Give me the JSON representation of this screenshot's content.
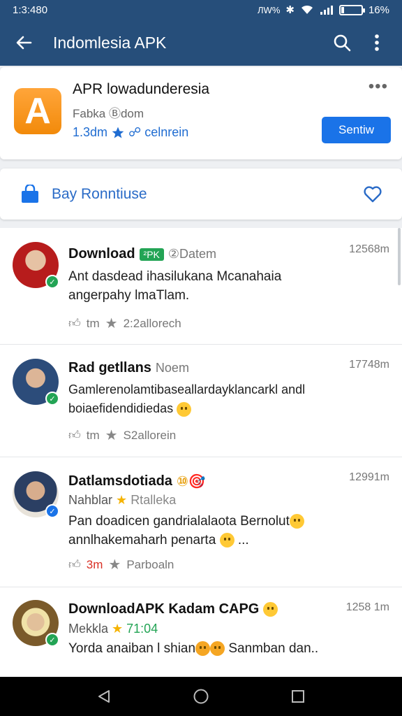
{
  "status_bar": {
    "time": "1:3:480",
    "network": "ЛW%",
    "battery_pct": "16%",
    "battery_level": 0.16
  },
  "app_bar": {
    "title": "Indomlesia APK",
    "icons": [
      "back-arrow-icon",
      "search-icon",
      "more-vert-icon"
    ]
  },
  "app_card": {
    "icon_letter": "A",
    "name": "APR lowadunderesia",
    "developer": "Fabka Ⓑdom",
    "rating": "1.3dm",
    "meta_tail": "celnrein",
    "more_label": "•••",
    "install_label": "Sentiw",
    "accent": "#1a73e8",
    "icon_color": "#f7971e"
  },
  "buy_card": {
    "label": "Bay Ronntiuse",
    "icons": [
      "shopping-bag-icon",
      "heart-icon"
    ]
  },
  "posts": [
    {
      "name": "Download",
      "badge": "²PK",
      "sub": "②Datem",
      "time": "12568m",
      "text1": "Ant dasdead ihasilukana Mcanahaia",
      "text2": "angerpahy lmaTlam.",
      "stat_a": "tm",
      "stat_b": "2:2allorech",
      "avatar_bg": "#b71c1c",
      "check_color": "#23a455"
    },
    {
      "name": "Rad getllans",
      "sub": "Noem",
      "time": "17748m",
      "text1": "Gamlerenolamtibaseallardayklancarkl andl",
      "text2": "boiaefidendidiedas",
      "stat_a": "tm",
      "stat_b": "S2allorein",
      "avatar_bg": "#3f6fa8",
      "check_color": "#23a455"
    },
    {
      "name": "Datlamsdotiada",
      "name_suffix": "⑩🎯",
      "line2_a": "Nahblar",
      "line2_b": "Rtalleka",
      "time": "12991m",
      "text1": "Pan doadicen gandrialalaota Bernolut",
      "text2": "annlhakemaharh penarta",
      "text2_tail": "...",
      "stat_a": "3m",
      "stat_b": "Parboaln",
      "avatar_bg": "#c9b79a",
      "check_color": "#1a73e8"
    },
    {
      "name": "DownloadAPK Kadam CAPG",
      "line2_a": "Mekkla",
      "line2_b": "71:04",
      "time": "1258 1m",
      "text1": "Yorda anaiban l shian",
      "text1_tail": "Sanmban dan..",
      "avatar_bg": "#7a5a2a",
      "check_color": "#23a455"
    }
  ],
  "nav_bar": {
    "icons": [
      "back-triangle-icon",
      "home-circle-icon",
      "recents-square-icon"
    ]
  }
}
